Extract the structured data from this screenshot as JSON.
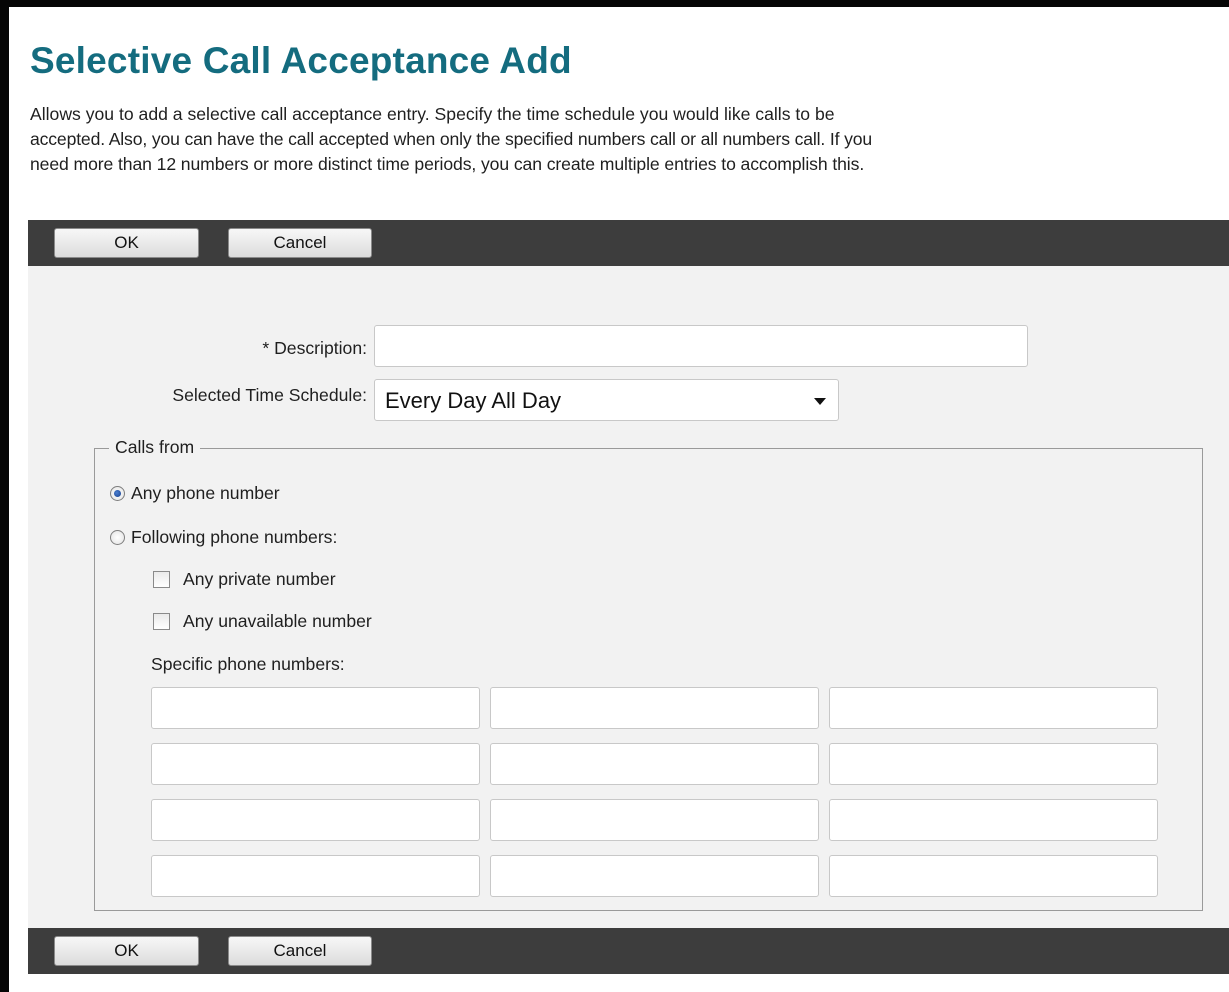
{
  "page": {
    "title": "Selective Call Acceptance Add",
    "description_lines": [
      "Allows you to add a selective call acceptance entry. Specify the time schedule you would like calls to be",
      "accepted. Also, you can have the call accepted when only the specified numbers call or all numbers call. If you",
      "need more than 12 numbers or more distinct time periods, you can create multiple entries to accomplish this."
    ]
  },
  "toolbar": {
    "ok_label": "OK",
    "cancel_label": "Cancel"
  },
  "form": {
    "description": {
      "label": "* Description:",
      "value": ""
    },
    "time_schedule": {
      "label": "Selected Time Schedule:",
      "selected": "Every Day All Day"
    },
    "calls_from": {
      "legend": "Calls from",
      "any_phone_label": "Any phone number",
      "any_phone_selected": true,
      "following_label": "Following phone numbers:",
      "following_selected": false,
      "any_private_label": "Any private number",
      "any_private_checked": false,
      "any_unavailable_label": "Any unavailable number",
      "any_unavailable_checked": false,
      "specific_label": "Specific phone numbers:",
      "specific_numbers": [
        "",
        "",
        "",
        "",
        "",
        "",
        "",
        "",
        "",
        "",
        "",
        ""
      ]
    }
  },
  "colors": {
    "title": "#146c7f",
    "toolbar_bg": "#3d3d3d",
    "panel_bg": "#f2f2f2",
    "radio_selected": "#1f4e9c"
  },
  "icons": [
    "dropdown-arrow-icon"
  ]
}
